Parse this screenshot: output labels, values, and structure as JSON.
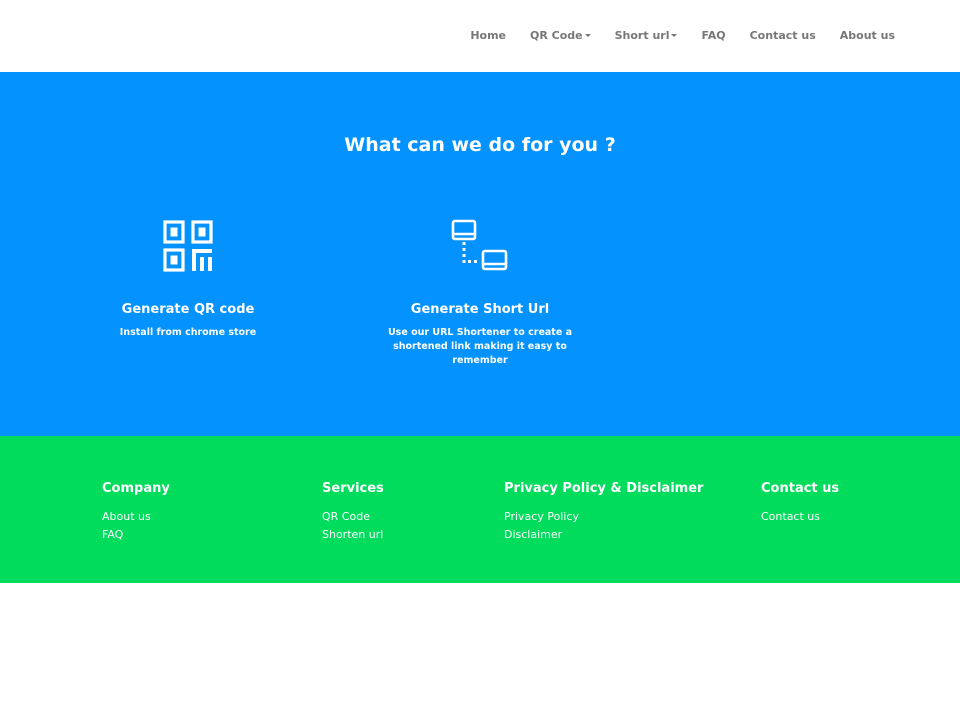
{
  "nav": {
    "items": [
      {
        "label": "Home",
        "dropdown": false
      },
      {
        "label": "QR Code",
        "dropdown": true
      },
      {
        "label": "Short url",
        "dropdown": true
      },
      {
        "label": "FAQ",
        "dropdown": false
      },
      {
        "label": "Contact us",
        "dropdown": false
      },
      {
        "label": "About us",
        "dropdown": false
      }
    ]
  },
  "hero": {
    "title": "What can we do for you ?",
    "background": "#0492fe",
    "features": [
      {
        "icon": "qr-code-icon",
        "title": "Generate QR code",
        "description": "Install from chrome store"
      },
      {
        "icon": "link-network-icon",
        "title": "Generate Short Url",
        "description": "Use our URL Shortener to create a shortened link making it easy to remember"
      }
    ]
  },
  "footer": {
    "background": "#02dc5c",
    "columns": [
      {
        "heading": "Company",
        "links": [
          "About us",
          "FAQ"
        ]
      },
      {
        "heading": "Services",
        "links": [
          "QR Code",
          "Shorten url"
        ]
      },
      {
        "heading": "Privacy Policy & Disclaimer",
        "links": [
          "Privacy Policy",
          "Disclaimer"
        ]
      },
      {
        "heading": "Contact us",
        "links": [
          "Contact us"
        ]
      }
    ]
  }
}
